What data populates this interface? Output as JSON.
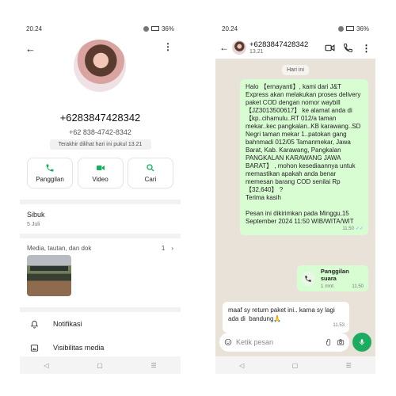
{
  "left": {
    "status": {
      "time": "20.24",
      "battery": "36%"
    },
    "contact": {
      "phone_display": "+6283847428342",
      "phone_formatted": "+62 838-4742-8342",
      "last_seen": "Terakhir dilihat hari ini pukul 13.21"
    },
    "actions": [
      {
        "label": "Panggilan",
        "icon": "phone-icon"
      },
      {
        "label": "Video",
        "icon": "video-icon"
      },
      {
        "label": "Cari",
        "icon": "search-icon"
      }
    ],
    "about": {
      "text": "Sibuk",
      "date": "5 Juli"
    },
    "media": {
      "label": "Media, tautan, dan dok",
      "count": "1",
      "arrow": "›"
    },
    "rows": [
      {
        "label": "Notifikasi",
        "icon": "bell-icon"
      },
      {
        "label": "Visibilitas media",
        "icon": "image-icon"
      }
    ],
    "nav": {
      "back": "◁",
      "home": "▢",
      "menu": "☰"
    }
  },
  "right": {
    "status": {
      "time": "20.24",
      "battery": "36%"
    },
    "header": {
      "number": "+6283847428342",
      "time": "13.21"
    },
    "today": "Hari ini",
    "outgoing_message": {
      "text": "Halo 【ernayanti】, kami dari J&T Express akan melakukan proses delivery paket COD dengan nomor waybill 【JZ3013500617】 ke alamat anda di 【kp..cihamulu..RT 012/a taman mekar..kec pangkalan..KB karawang..SD Negri taman mekar 1..patokan gang bahnmadi 012/05 Tamanmekar, Jawa Barat, Kab. Karawang, Pangkalan PANGKALAN KARAWANG JAWA BARAT】 , mohon kesediaannya untuk memastikan apakah anda benar memesan barang COD senilai Rp 【32,640】 ?\nTerima kasih\n\nPesan ini dikirimkan pada Minggu,15 September 2024 11:50 WIB/WITA/WIT",
      "time": "11.50"
    },
    "call": {
      "title": "Panggilan suara",
      "duration": "1 mnt",
      "time": "11.50"
    },
    "incoming_message": {
      "text": "maaf sy return paket ini.. karna sy lagi ada di  bandung🙏",
      "time": "11.53"
    },
    "input": {
      "placeholder": "Ketik pesan"
    },
    "nav": {
      "back": "◁",
      "home": "▢",
      "menu": "☰"
    }
  }
}
